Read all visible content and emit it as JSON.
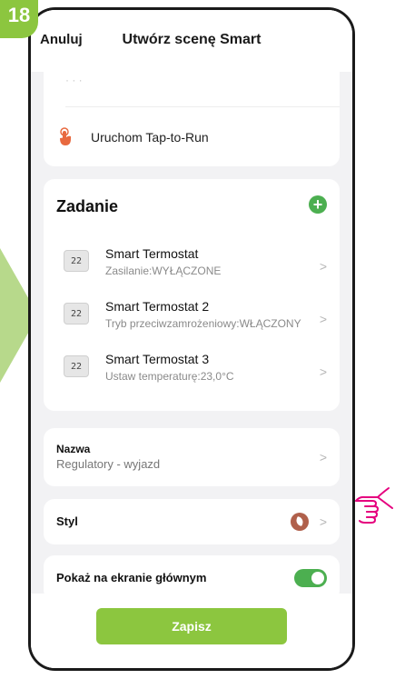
{
  "step_badge": "18",
  "header": {
    "cancel_label": "Anuluj",
    "title": "Utwórz scenę Smart"
  },
  "trigger_card": {
    "tap_to_run_label": "Uruchom Tap-to-Run",
    "icon": "hand-tap-icon"
  },
  "tasks": {
    "heading": "Zadanie",
    "add_icon": "plus-icon",
    "items": [
      {
        "name": "Smart Termostat",
        "detail": "Zasilanie:WYŁĄCZONE",
        "icon_text": "22"
      },
      {
        "name": "Smart Termostat 2",
        "detail": "Tryb przeciwzamrożeniowy:WŁĄCZONY",
        "icon_text": "22"
      },
      {
        "name": "Smart Termostat 3",
        "detail": "Ustaw temperaturę:23,0°C",
        "icon_text": "22"
      }
    ]
  },
  "name_row": {
    "label": "Nazwa",
    "value": "Regulatory - wyjazd"
  },
  "style_row": {
    "label": "Styl",
    "icon": "tag-icon"
  },
  "home_row": {
    "label": "Pokaż na ekranie głównym",
    "toggle_on": true
  },
  "save_label": "Zapisz",
  "colors": {
    "accent_green": "#8cc63f",
    "toggle_green": "#4caf50",
    "style_icon": "#b0604b"
  }
}
